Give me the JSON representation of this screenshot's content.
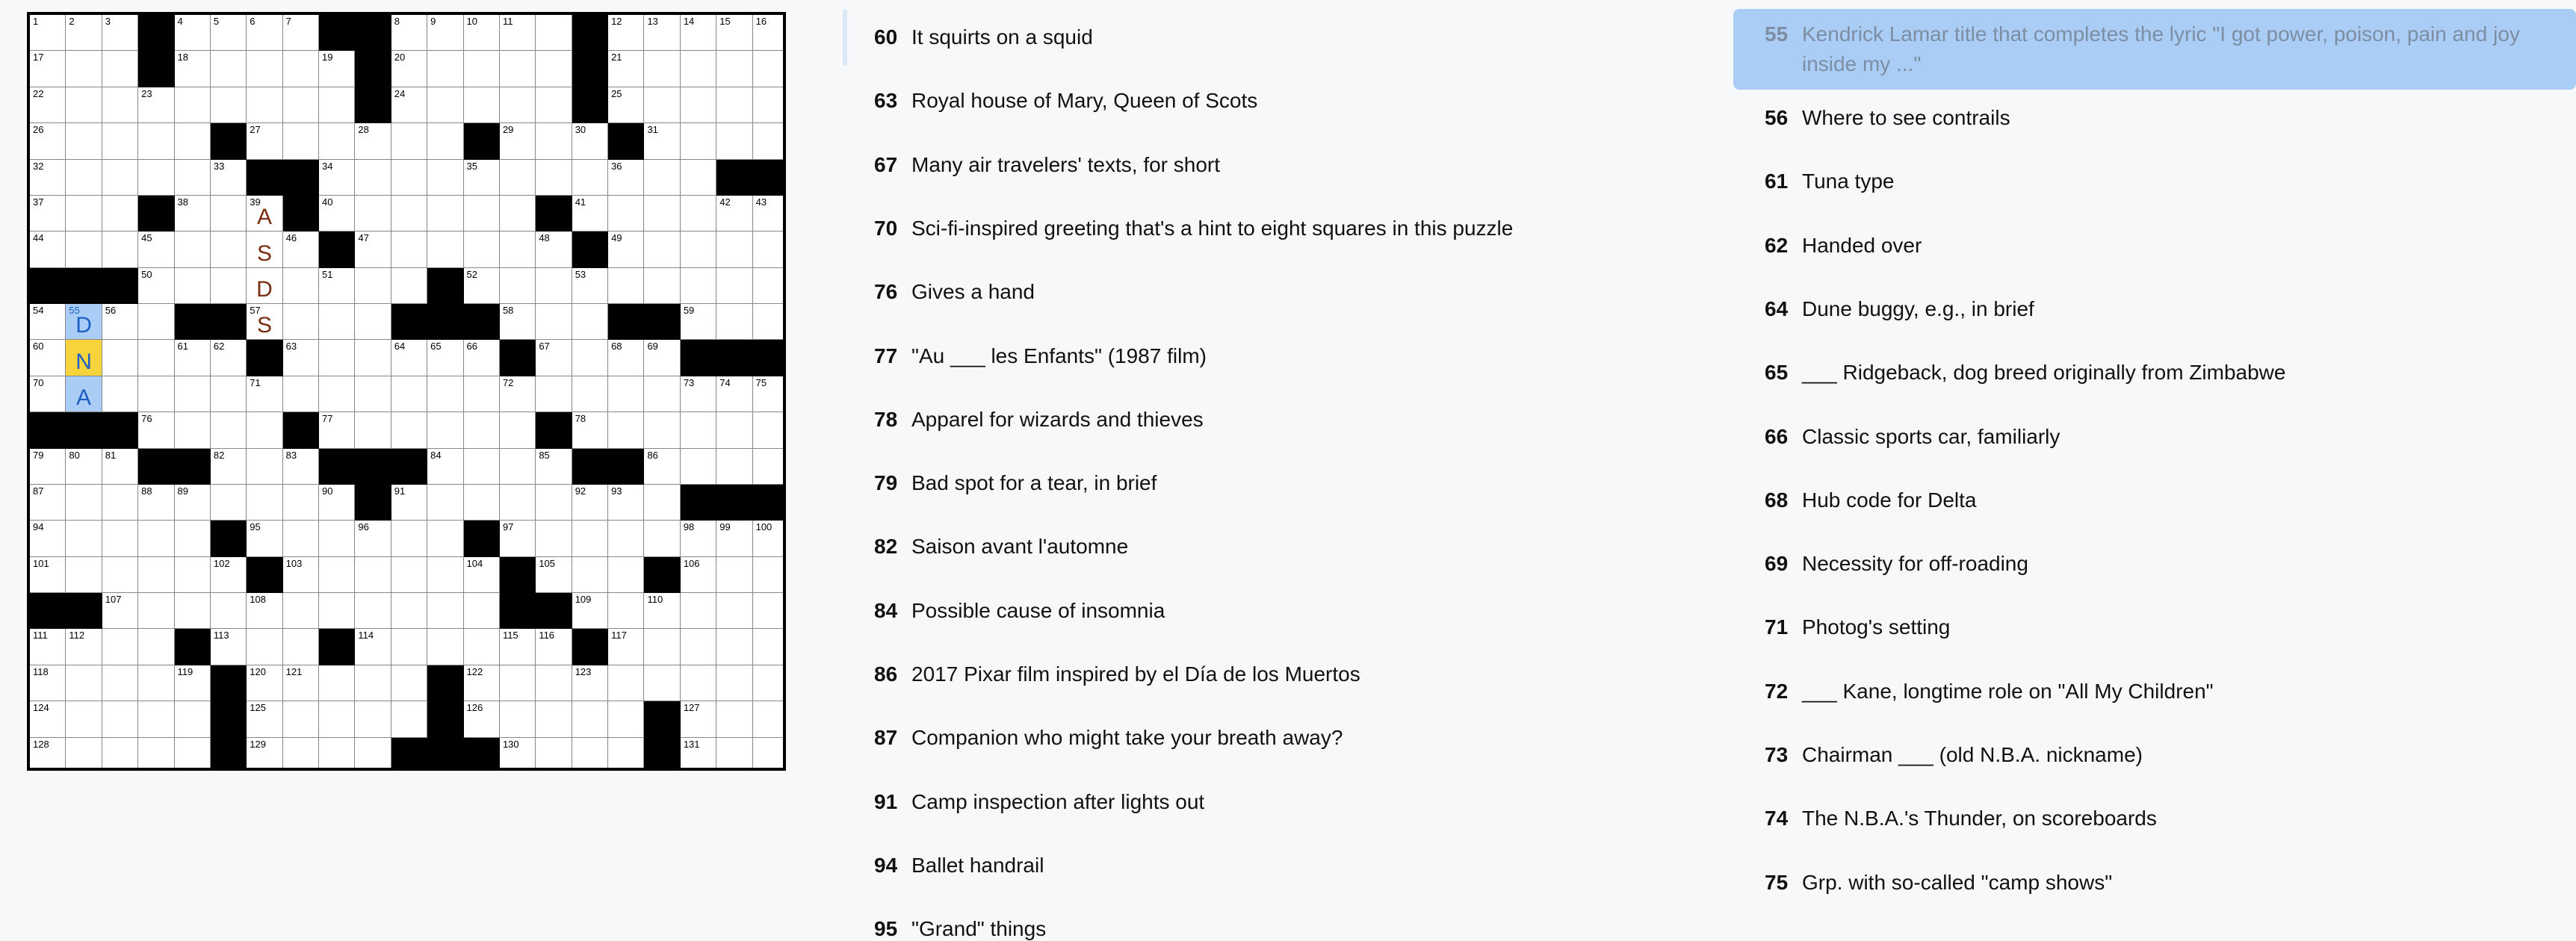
{
  "grid": {
    "size": 21,
    "rows": [
      "...#...##....#.....",
      "...#...#.........#....",
      "...",
      "..."
    ],
    "pattern": [
      "...#....###....#....",
      "...#.....#.....#....",
      "..........#....#....",
      ".....#....#.#...#...",
      ".....##.....#.....##",
      "...#..#.#...#.#.....",
      ".......#.......#....",
      "###....#...#.......#",
      "......###.....####....",
      "......#...#.#...####",
      "..............#.....",
      "###...#.....#.......",
      ".....#####....##....",
      "......#.#......#####",
      ".....#...#....#.....",
      "...#.#....#...#.....",
      "##......#....#..#...",
      "...#....#....#......",
      "......#....#........",
      "......#....#...#....",
      "......#...###..#...."
    ]
  },
  "across_clues": [
    {
      "num": "60",
      "text": "It squirts on a squid"
    },
    {
      "num": "63",
      "text": "Royal house of Mary, Queen of Scots"
    },
    {
      "num": "67",
      "text": "Many air travelers' texts, for short"
    },
    {
      "num": "70",
      "text": "Sci-fi-inspired greeting that's a hint to eight squares in this puzzle"
    },
    {
      "num": "76",
      "text": "Gives a hand"
    },
    {
      "num": "77",
      "text": "\"Au ___ les Enfants\" (1987 film)"
    },
    {
      "num": "78",
      "text": "Apparel for wizards and thieves"
    },
    {
      "num": "79",
      "text": "Bad spot for a tear, in brief"
    },
    {
      "num": "82",
      "text": "Saison avant l'automne"
    },
    {
      "num": "84",
      "text": "Possible cause of insomnia"
    },
    {
      "num": "86",
      "text": "2017 Pixar film inspired by el Día de los Muertos"
    },
    {
      "num": "87",
      "text": "Companion who might take your breath away?"
    },
    {
      "num": "91",
      "text": "Camp inspection after lights out"
    },
    {
      "num": "94",
      "text": "Ballet handrail"
    },
    {
      "num": "95",
      "text": "\"Grand\" things"
    }
  ],
  "down_clues": [
    {
      "num": "55",
      "text": "Kendrick Lamar title that completes the lyric \"I got power, poison, pain and joy inside my ...\"",
      "selected": true
    },
    {
      "num": "56",
      "text": "Where to see contrails"
    },
    {
      "num": "61",
      "text": "Tuna type"
    },
    {
      "num": "62",
      "text": "Handed over"
    },
    {
      "num": "64",
      "text": "Dune buggy, e.g., in brief"
    },
    {
      "num": "65",
      "text": "___ Ridgeback, dog breed originally from Zimbabwe"
    },
    {
      "num": "66",
      "text": "Classic sports car, familiarly"
    },
    {
      "num": "68",
      "text": "Hub code for Delta"
    },
    {
      "num": "69",
      "text": "Necessity for off-roading"
    },
    {
      "num": "71",
      "text": "Photog's setting"
    },
    {
      "num": "72",
      "text": "___ Kane, longtime role on \"All My Children\""
    },
    {
      "num": "73",
      "text": "Chairman ___ (old N.B.A. nickname)"
    },
    {
      "num": "74",
      "text": "The N.B.A.'s Thunder, on scoreboards"
    },
    {
      "num": "75",
      "text": "Grp. with so-called \"camp shows\""
    }
  ],
  "colors": {
    "highlight": "#aacdf5",
    "current_cell": "#f7d43c",
    "pencil_letter": "#7a2d10",
    "ink_letter": "#1b5fc7"
  }
}
